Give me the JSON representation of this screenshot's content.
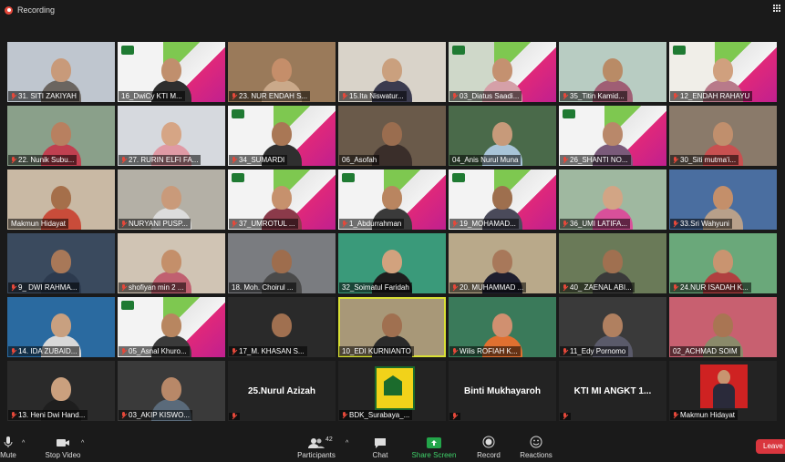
{
  "window": {
    "recording_label": "Recording",
    "view_label": "View"
  },
  "colors": {
    "active_speaker": "#d9e035",
    "leave": "#d9363e",
    "share": "#23a54a",
    "muted": "#e5483a"
  },
  "tiles": [
    {
      "name": "31. SITI ZAKIYAH",
      "bg": "#bfc6cf",
      "skin": "#c89a7a",
      "shirt": "#6b6560",
      "muted": true
    },
    {
      "name": "16_DwiCy KTI M...",
      "bg": "#f3f3f3",
      "skin": "#c08f6d",
      "shirt": "#2e2e2e",
      "banner": true,
      "muted": false
    },
    {
      "name": "23. NUR ENDAH S...",
      "bg": "#9a7a5a",
      "skin": "#c58e6a",
      "shirt": "#caa98a",
      "muted": true
    },
    {
      "name": "15.Ita Niswatur...",
      "bg": "#d9d3c9",
      "skin": "#caa07e",
      "shirt": "#3b3b4f",
      "muted": true
    },
    {
      "name": "03_Diatus Saadi...",
      "bg": "#cfd8c9",
      "skin": "#c49170",
      "shirt": "#d5a0a8",
      "banner": true,
      "muted": true
    },
    {
      "name": "35_Titin Kamid...",
      "bg": "#b8ccc2",
      "skin": "#b98b66",
      "shirt": "#9f5e74",
      "muted": true
    },
    {
      "name": "12_ENDAH RAHAYU",
      "bg": "#f0eee8",
      "skin": "#d0a07e",
      "shirt": "#b87a8a",
      "banner": true,
      "muted": true
    },
    {
      "name": "22. Nunik Subu...",
      "bg": "#8aa08a",
      "skin": "#b88060",
      "shirt": "#c04050",
      "muted": true
    },
    {
      "name": "27. RURIN ELFI FA...",
      "bg": "#d6d9de",
      "skin": "#d6a585",
      "shirt": "#e09aa5",
      "muted": true
    },
    {
      "name": "34_SUMARDI",
      "bg": "#f3f3f3",
      "skin": "#a97755",
      "shirt": "#2f2f2f",
      "banner": true,
      "muted": true
    },
    {
      "name": "06_Asofah",
      "bg": "#6a5a4a",
      "skin": "#9a6d4f",
      "shirt": "#3a2e2a",
      "muted": false
    },
    {
      "name": "04_Anis Nurul Muna",
      "bg": "#4a6a4a",
      "skin": "#c79a7a",
      "shirt": "#a8c4d8",
      "muted": false
    },
    {
      "name": "26_SHANTI NO...",
      "bg": "#f3f3f3",
      "skin": "#b9886a",
      "shirt": "#7a5a7a",
      "banner": true,
      "muted": true
    },
    {
      "name": "30_Siti mutma'i...",
      "bg": "#8a7a6a",
      "skin": "#c08f6d",
      "shirt": "#c85050",
      "muted": true
    },
    {
      "name": "Makmun Hidayat",
      "bg": "#c9b9a4",
      "skin": "#a56f4a",
      "shirt": "#c94c3a",
      "muted": false
    },
    {
      "name": "NURYANI PUSP...",
      "bg": "#b4b0a6",
      "skin": "#c99a7a",
      "shirt": "#dcdcdc",
      "muted": true
    },
    {
      "name": "37_UMROTUL ...",
      "bg": "#f3f3f3",
      "skin": "#c6916d",
      "shirt": "#8b3a4a",
      "banner": true,
      "muted": true
    },
    {
      "name": "1_Abdurrahman",
      "bg": "#f3f3f3",
      "skin": "#b98560",
      "shirt": "#3a3a3a",
      "banner": true,
      "muted": true
    },
    {
      "name": "19_MOHAMAD...",
      "bg": "#f3f3f3",
      "skin": "#9e6f4e",
      "shirt": "#4a4a5a",
      "banner": true,
      "muted": true
    },
    {
      "name": "36_UMI LATIFA...",
      "bg": "#9fb8a0",
      "skin": "#d2a585",
      "shirt": "#d8509a",
      "muted": true
    },
    {
      "name": "33.Sri Wahyuni",
      "bg": "#4a6ea0",
      "skin": "#c48f6a",
      "shirt": "#b8a08a",
      "muted": true
    },
    {
      "name": "9_ DWI RAHMA...",
      "bg": "#3a4a5e",
      "skin": "#a87858",
      "shirt": "#2c3a4e",
      "muted": true
    },
    {
      "name": "shofiyan min 2 ...",
      "bg": "#d0c4b4",
      "skin": "#c48f6a",
      "shirt": "#c06070",
      "muted": true
    },
    {
      "name": "18. Moh. Choirul ...",
      "bg": "#7a7c80",
      "skin": "#9e6d4d",
      "shirt": "#4a4a4a",
      "muted": false
    },
    {
      "name": "32_Soimatul Faridah",
      "bg": "#3a9a7a",
      "skin": "#d2a27e",
      "shirt": "#1e1e1e",
      "muted": false
    },
    {
      "name": "20. MUHAMMAD ...",
      "bg": "#b9a98a",
      "skin": "#a8785a",
      "shirt": "#1e1e2e",
      "muted": true
    },
    {
      "name": "40_ ZAENAL ABI...",
      "bg": "#6a7a58",
      "skin": "#a07050",
      "shirt": "#3a3a3a",
      "muted": true
    },
    {
      "name": "24.NUR ISADAH K...",
      "bg": "#6aa87a",
      "skin": "#c99470",
      "shirt": "#b04040",
      "muted": true
    },
    {
      "name": "14. IDA ZUBAID...",
      "bg": "#2a6aa0",
      "skin": "#c8a080",
      "shirt": "#d8d8d8",
      "muted": true
    },
    {
      "name": "05_Asnal Khuro...",
      "bg": "#f3f3f3",
      "skin": "#b88660",
      "shirt": "#3a3a3a",
      "banner": true,
      "muted": true
    },
    {
      "name": "17_M. KHASAN S...",
      "bg": "#2a2a2a",
      "skin": "#a07050",
      "shirt": "#2a2a2a",
      "muted": true
    },
    {
      "name": "10_EDI KURNIANTO",
      "bg": "#a89878",
      "skin": "#a07050",
      "shirt": "#2a2a2a",
      "active": true,
      "muted": false
    },
    {
      "name": "Wilis ROFIAH K...",
      "bg": "#3a7a5a",
      "skin": "#d09070",
      "shirt": "#e07030",
      "muted": true
    },
    {
      "name": "11_Edy Pornomo",
      "bg": "#3a3a3a",
      "skin": "#b08060",
      "shirt": "#5a5a6a",
      "muted": true
    },
    {
      "name": "02_ACHMAD SOIM",
      "bg": "#c86070",
      "skin": "#a97553",
      "shirt": "#8a8a6a",
      "muted": false
    },
    {
      "name": "13. Heni Dwi Hand...",
      "bg": "#2a2a2a",
      "skin": "#caa07e",
      "shirt": "#1e1e1e",
      "muted": true
    },
    {
      "name": "03_AKIP KISWO...",
      "bg": "#3a3a3a",
      "skin": "#b88868",
      "shirt": "#5a6a7a",
      "muted": true
    },
    {
      "name": "",
      "text": "25.Nurul Azizah",
      "bg": "#232323",
      "muted": true
    },
    {
      "name": "BDK_Surabaya_...",
      "bg": "#232323",
      "logo": true,
      "muted": true
    },
    {
      "name": "",
      "text": "Binti Mukhayaroh",
      "bg": "#232323",
      "muted": true
    },
    {
      "name": "",
      "text": "KTI MI ANGKT 1...",
      "bg": "#232323",
      "muted": true
    },
    {
      "name": "Makmun Hidayat",
      "bg": "#232323",
      "idphoto": true,
      "muted": true
    }
  ],
  "toolbar": {
    "mute": "Mute",
    "stop_video": "Stop Video",
    "participants": "Participants",
    "participants_count": "42",
    "chat": "Chat",
    "share_screen": "Share Screen",
    "record": "Record",
    "reactions": "Reactions",
    "leave": "Leave"
  }
}
